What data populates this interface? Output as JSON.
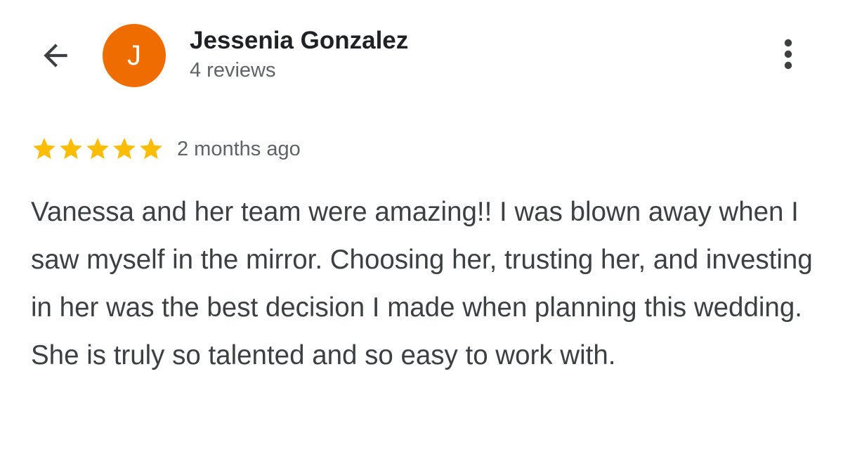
{
  "header": {
    "back_icon": "arrow-left-icon",
    "more_icon": "more-vert-icon",
    "avatar_letter": "J",
    "avatar_color": "#ef6c00",
    "reviewer_name": "Jessenia Gonzalez",
    "review_count": "4 reviews"
  },
  "review": {
    "rating": 5,
    "rating_max": 5,
    "star_color": "#fbbc04",
    "star_icon": "star-icon",
    "date": "2 months ago",
    "text": "Vanessa and her team were amazing!! I was blown away when I saw myself in the mirror. Choosing her, trusting her, and investing in her was the best decision I made when planning this wedding. She is truly so talented and so easy to work with."
  }
}
